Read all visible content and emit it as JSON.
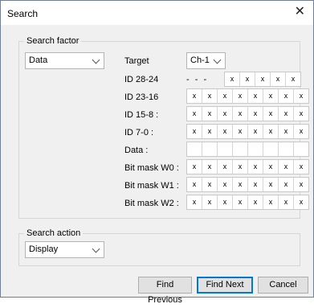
{
  "window": {
    "title": "Search",
    "close_symbol": "✕"
  },
  "search_factor": {
    "legend": "Search factor",
    "type_value": "Data",
    "target_label": "Target",
    "target_value": "Ch-1",
    "id_28_24_label": "ID 28-24",
    "id_28_24_dots": "- - -",
    "id_28_24_cells": [
      "x",
      "x",
      "x",
      "x",
      "x"
    ],
    "id_23_16_label": "ID 23-16",
    "id_23_16_cells": [
      "x",
      "x",
      "x",
      "x",
      "x",
      "x",
      "x",
      "x"
    ],
    "id_15_8_label": "ID 15-8 :",
    "id_15_8_cells": [
      "x",
      "x",
      "x",
      "x",
      "x",
      "x",
      "x",
      "x"
    ],
    "id_7_0_label": "ID 7-0 :",
    "id_7_0_cells": [
      "x",
      "x",
      "x",
      "x",
      "x",
      "x",
      "x",
      "x"
    ],
    "data_label": "Data :",
    "data_cells": [
      "",
      "",
      "",
      "",
      "",
      "",
      "",
      ""
    ],
    "bitmask_w0_label": "Bit mask W0 :",
    "bitmask_w0_cells": [
      "x",
      "x",
      "x",
      "x",
      "x",
      "x",
      "x",
      "x"
    ],
    "bitmask_w1_label": "Bit mask W1 :",
    "bitmask_w1_cells": [
      "x",
      "x",
      "x",
      "x",
      "x",
      "x",
      "x",
      "x"
    ],
    "bitmask_w2_label": "Bit mask W2 :",
    "bitmask_w2_cells": [
      "x",
      "x",
      "x",
      "x",
      "x",
      "x",
      "x",
      "x"
    ]
  },
  "search_action": {
    "legend": "Search action",
    "value": "Display"
  },
  "buttons": {
    "find_previous": "Find Previous",
    "find_next": "Find Next",
    "cancel": "Cancel"
  }
}
